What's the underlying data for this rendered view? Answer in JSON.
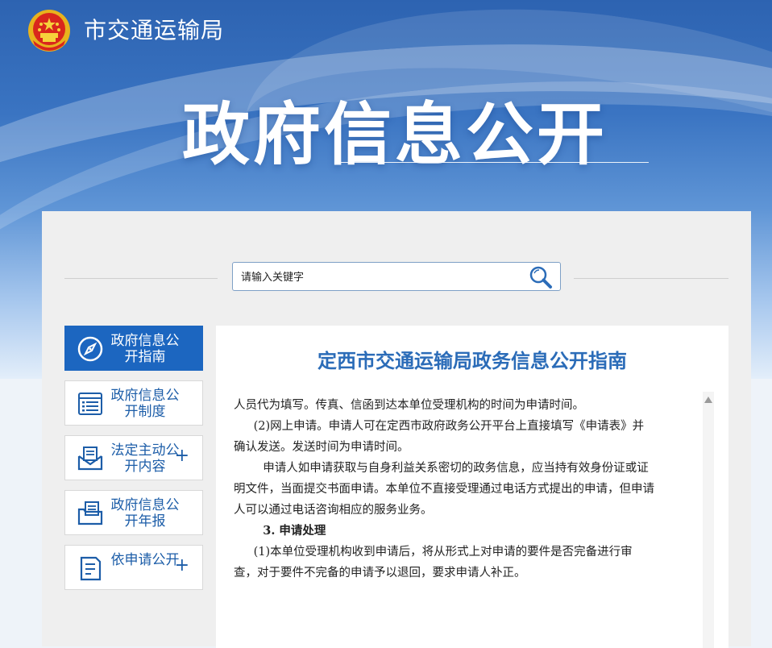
{
  "header": {
    "agency_name": "市交通运输局",
    "hero_title": "政府信息公开"
  },
  "search": {
    "placeholder": "请输入关键字"
  },
  "sidebar": {
    "items": [
      {
        "label": "政府信息公开指南",
        "icon": "compass-icon",
        "active": true,
        "expandable": false
      },
      {
        "label": "政府信息公开制度",
        "icon": "list-document-icon",
        "active": false,
        "expandable": false
      },
      {
        "label": "法定主动公开内容",
        "icon": "envelope-document-icon",
        "active": false,
        "expandable": true
      },
      {
        "label": "政府信息公开年报",
        "icon": "folder-document-icon",
        "active": false,
        "expandable": false
      },
      {
        "label": "依申请公开",
        "icon": "clipboard-icon",
        "active": false,
        "expandable": true
      }
    ],
    "expand_symbol": "+"
  },
  "content": {
    "title": "定西市交通运输局政务信息公开指南",
    "paragraphs": [
      "人员代为填写。传真、信函到达本单位受理机构的时间为申请时间。",
      "(2)网上申请。申请人可在定西市政府政务公开平台上直接填写《申请表》并确认发送。发送时间为申请时间。",
      "申请人如申请获取与自身利益关系密切的政务信息，应当持有效身份证或证明文件，当面提交书面申请。本单位不直接受理通过电话方式提出的申请，但申请人可以通过电话咨询相应的服务业务。",
      "3. 申请处理",
      "(1)本单位受理机构收到申请后，将从形式上对申请的要件是否完备进行审查，对于要件不完备的申请予以退回，要求申请人补正。"
    ]
  },
  "colors": {
    "accent": "#1c66c0",
    "title_blue": "#2b6cb8",
    "nav_text": "#1c5da8"
  }
}
